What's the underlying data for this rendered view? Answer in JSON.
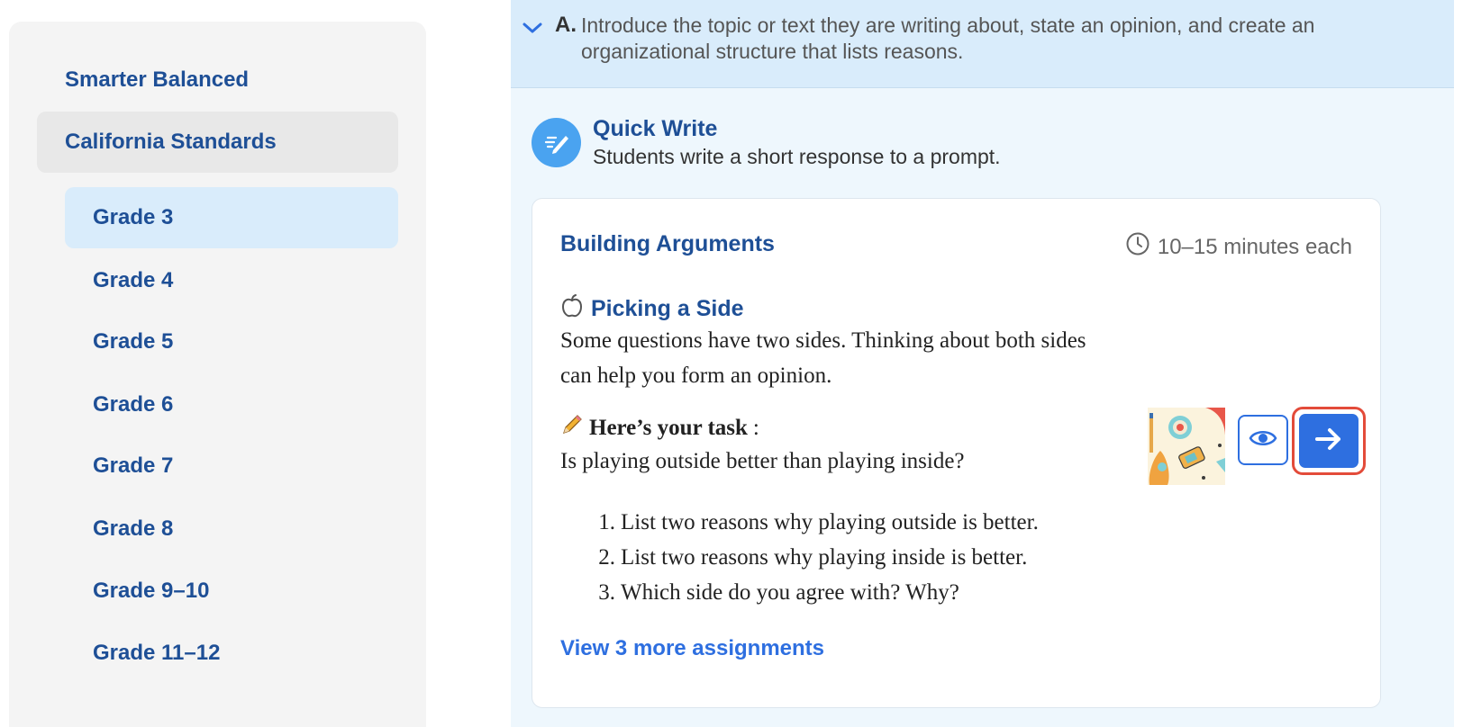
{
  "sidebar": {
    "items": [
      {
        "label": "Smarter Balanced"
      },
      {
        "label": "California Standards"
      }
    ],
    "grades": [
      {
        "label": "Grade 3"
      },
      {
        "label": "Grade 4"
      },
      {
        "label": "Grade 5"
      },
      {
        "label": "Grade 6"
      },
      {
        "label": "Grade 7"
      },
      {
        "label": "Grade 8"
      },
      {
        "label": "Grade 9–10"
      },
      {
        "label": "Grade 11–12"
      }
    ]
  },
  "standard": {
    "letter": "A.",
    "text": "Introduce the topic or text they are writing about, state an opinion, and create an organizational structure that lists reasons."
  },
  "quick_write": {
    "title": "Quick Write",
    "description": "Students write a short response to a prompt."
  },
  "card": {
    "title": "Building Arguments",
    "time": "10–15 minutes each",
    "task_title": "Picking a Side",
    "task_description": "Some questions have two sides. Thinking about both sides can help you form an opinion.",
    "task_label": "Here’s your task",
    "task_label_suffix": ":",
    "task_question": "Is playing outside better than playing inside?",
    "steps": [
      {
        "num": "1.",
        "text": "List two reasons why playing outside is better."
      },
      {
        "num": "2.",
        "text": "List two reasons why playing inside is better."
      },
      {
        "num": "3.",
        "text": "Which side do you agree with? Why?"
      }
    ],
    "more_link": "View 3 more assignments"
  },
  "icons": {
    "chevron": "chevron-down-icon",
    "quick_write": "pencil-write-icon",
    "clock": "clock-icon",
    "apple": "apple-icon",
    "pencil": "pencil-icon",
    "eye": "eye-icon",
    "arrow": "arrow-right-icon"
  },
  "colors": {
    "brand_blue": "#1e4f96",
    "accent_blue": "#2e6fe0",
    "highlight_red": "#e34b3a"
  }
}
